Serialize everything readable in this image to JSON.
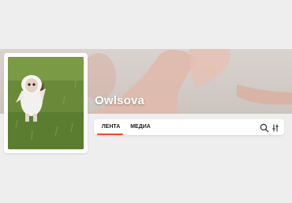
{
  "profile": {
    "name": "Owlsova"
  },
  "tabs": [
    {
      "label": "ЛЕНТА",
      "active": true
    },
    {
      "label": "МЕДИА",
      "active": false
    }
  ],
  "toolbar": {
    "icons": [
      "search-icon",
      "filter-icon"
    ]
  },
  "colors": {
    "accent": "#e8501f",
    "page_background": "#eeeeee",
    "card_background": "#ffffff"
  }
}
